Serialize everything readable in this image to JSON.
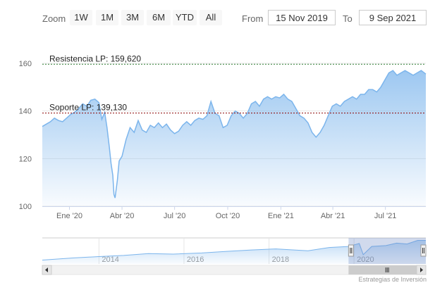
{
  "toolbar": {
    "zoom_label": "Zoom",
    "buttons": [
      "1W",
      "1M",
      "3M",
      "6M",
      "YTD",
      "All"
    ],
    "from_label": "From",
    "from_value": "15 Nov 2019",
    "to_label": "To",
    "to_value": "9 Sep 2021"
  },
  "credit": "Estrategias de Inversión",
  "colors": {
    "line": "#7cb5ec",
    "resistance": "#2e7d32",
    "support": "#8b0000"
  },
  "chart_data": {
    "type": "area",
    "title": "",
    "xlabel": "",
    "ylabel": "",
    "ylim": [
      100,
      160
    ],
    "xlim": [
      "2019-11-15",
      "2021-09-09"
    ],
    "y_ticks": [
      100,
      120,
      140,
      160
    ],
    "x_ticks": [
      {
        "date": "2020-01-01",
        "label": "Ene '20"
      },
      {
        "date": "2020-04-01",
        "label": "Abr '20"
      },
      {
        "date": "2020-07-01",
        "label": "Jul '20"
      },
      {
        "date": "2020-10-01",
        "label": "Oct '20"
      },
      {
        "date": "2021-01-01",
        "label": "Ene '21"
      },
      {
        "date": "2021-04-01",
        "label": "Abr '21"
      },
      {
        "date": "2021-07-01",
        "label": "Jul '21"
      }
    ],
    "grid": true,
    "series": [
      {
        "values": [
          [
            "2019-11-15",
            133.5
          ],
          [
            "2019-11-22",
            134.5
          ],
          [
            "2019-11-29",
            135.5
          ],
          [
            "2019-12-06",
            137
          ],
          [
            "2019-12-13",
            136
          ],
          [
            "2019-12-20",
            135.5
          ],
          [
            "2019-12-27",
            137
          ],
          [
            "2020-01-03",
            138.5
          ],
          [
            "2020-01-10",
            139.5
          ],
          [
            "2020-01-17",
            141
          ],
          [
            "2020-01-24",
            143
          ],
          [
            "2020-01-31",
            142
          ],
          [
            "2020-02-07",
            144.5
          ],
          [
            "2020-02-14",
            145
          ],
          [
            "2020-02-21",
            143.5
          ],
          [
            "2020-02-26",
            136.5
          ],
          [
            "2020-03-02",
            139.5
          ],
          [
            "2020-03-06",
            133
          ],
          [
            "2020-03-10",
            125
          ],
          [
            "2020-03-13",
            118
          ],
          [
            "2020-03-16",
            113
          ],
          [
            "2020-03-18",
            105
          ],
          [
            "2020-03-20",
            103.5
          ],
          [
            "2020-03-24",
            111
          ],
          [
            "2020-03-27",
            119
          ],
          [
            "2020-04-01",
            121
          ],
          [
            "2020-04-08",
            128
          ],
          [
            "2020-04-15",
            133
          ],
          [
            "2020-04-22",
            131
          ],
          [
            "2020-04-29",
            136
          ],
          [
            "2020-05-06",
            132
          ],
          [
            "2020-05-13",
            131
          ],
          [
            "2020-05-20",
            134
          ],
          [
            "2020-05-27",
            133
          ],
          [
            "2020-06-03",
            135
          ],
          [
            "2020-06-10",
            133
          ],
          [
            "2020-06-17",
            134.5
          ],
          [
            "2020-06-24",
            132
          ],
          [
            "2020-07-01",
            130.5
          ],
          [
            "2020-07-08",
            131.5
          ],
          [
            "2020-07-15",
            134
          ],
          [
            "2020-07-22",
            135.5
          ],
          [
            "2020-07-29",
            134
          ],
          [
            "2020-08-05",
            136
          ],
          [
            "2020-08-12",
            137
          ],
          [
            "2020-08-19",
            136.5
          ],
          [
            "2020-08-26",
            138
          ],
          [
            "2020-09-02",
            144
          ],
          [
            "2020-09-09",
            139
          ],
          [
            "2020-09-16",
            138
          ],
          [
            "2020-09-23",
            133
          ],
          [
            "2020-09-30",
            134
          ],
          [
            "2020-10-07",
            138
          ],
          [
            "2020-10-14",
            140
          ],
          [
            "2020-10-21",
            139
          ],
          [
            "2020-10-28",
            137
          ],
          [
            "2020-11-04",
            139
          ],
          [
            "2020-11-11",
            143
          ],
          [
            "2020-11-18",
            144
          ],
          [
            "2020-11-25",
            142
          ],
          [
            "2020-12-02",
            145
          ],
          [
            "2020-12-09",
            146
          ],
          [
            "2020-12-16",
            145
          ],
          [
            "2020-12-23",
            146
          ],
          [
            "2020-12-30",
            145.5
          ],
          [
            "2021-01-06",
            147
          ],
          [
            "2021-01-13",
            145
          ],
          [
            "2021-01-20",
            144
          ],
          [
            "2021-01-27",
            141
          ],
          [
            "2021-02-03",
            138
          ],
          [
            "2021-02-10",
            137
          ],
          [
            "2021-02-17",
            135
          ],
          [
            "2021-02-24",
            131
          ],
          [
            "2021-03-03",
            129
          ],
          [
            "2021-03-10",
            131
          ],
          [
            "2021-03-17",
            134
          ],
          [
            "2021-03-24",
            138
          ],
          [
            "2021-03-31",
            142
          ],
          [
            "2021-04-07",
            143
          ],
          [
            "2021-04-14",
            142
          ],
          [
            "2021-04-21",
            144
          ],
          [
            "2021-04-28",
            145
          ],
          [
            "2021-05-05",
            146
          ],
          [
            "2021-05-12",
            145
          ],
          [
            "2021-05-19",
            147
          ],
          [
            "2021-05-26",
            147
          ],
          [
            "2021-06-02",
            149
          ],
          [
            "2021-06-09",
            149
          ],
          [
            "2021-06-16",
            148
          ],
          [
            "2021-06-23",
            150
          ],
          [
            "2021-06-30",
            153
          ],
          [
            "2021-07-07",
            156
          ],
          [
            "2021-07-14",
            157
          ],
          [
            "2021-07-21",
            155
          ],
          [
            "2021-07-28",
            156
          ],
          [
            "2021-08-04",
            157
          ],
          [
            "2021-08-11",
            156
          ],
          [
            "2021-08-18",
            155
          ],
          [
            "2021-08-25",
            156
          ],
          [
            "2021-09-01",
            157
          ],
          [
            "2021-09-09",
            155.5
          ]
        ]
      }
    ],
    "annotations": [
      {
        "label": "Resistencia LP: 159,620",
        "value": 159.62
      },
      {
        "label": "Soporte LP: 139,130",
        "value": 139.13
      }
    ],
    "navigator": {
      "xlim": [
        "2012-09-01",
        "2021-09-09"
      ],
      "x_ticks": [
        {
          "date": "2014-01-01",
          "label": "2014"
        },
        {
          "date": "2016-01-01",
          "label": "2016"
        },
        {
          "date": "2018-01-01",
          "label": "2018"
        },
        {
          "date": "2020-01-01",
          "label": "2020"
        }
      ],
      "values": [
        [
          "2012-09-01",
          84
        ],
        [
          "2013-06-01",
          92
        ],
        [
          "2014-01-01",
          97
        ],
        [
          "2014-08-01",
          101
        ],
        [
          "2015-03-01",
          108
        ],
        [
          "2015-10-01",
          106
        ],
        [
          "2016-06-01",
          110
        ],
        [
          "2017-01-01",
          116
        ],
        [
          "2017-08-01",
          121
        ],
        [
          "2018-03-01",
          125
        ],
        [
          "2018-12-01",
          118
        ],
        [
          "2019-06-01",
          130
        ],
        [
          "2019-11-15",
          134
        ],
        [
          "2020-02-15",
          145
        ],
        [
          "2020-03-20",
          104
        ],
        [
          "2020-06-01",
          134
        ],
        [
          "2020-10-01",
          137
        ],
        [
          "2021-01-01",
          146
        ],
        [
          "2021-04-01",
          143
        ],
        [
          "2021-07-01",
          156
        ],
        [
          "2021-09-09",
          156
        ]
      ],
      "ylim": [
        70,
        165
      ]
    }
  }
}
